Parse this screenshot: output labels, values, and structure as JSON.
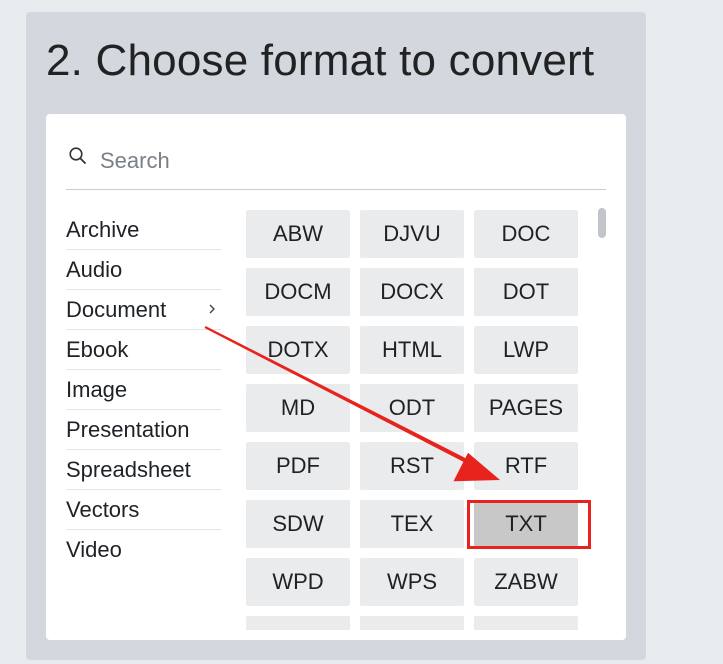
{
  "title": "2. Choose format to convert",
  "search": {
    "placeholder": "Search"
  },
  "categories": [
    {
      "label": "Archive"
    },
    {
      "label": "Audio"
    },
    {
      "label": "Document"
    },
    {
      "label": "Ebook"
    },
    {
      "label": "Image"
    },
    {
      "label": "Presentation"
    },
    {
      "label": "Spreadsheet"
    },
    {
      "label": "Vectors"
    },
    {
      "label": "Video"
    }
  ],
  "active_category": "Document",
  "formats": [
    "ABW",
    "DJVU",
    "DOC",
    "DOCM",
    "DOCX",
    "DOT",
    "DOTX",
    "HTML",
    "LWP",
    "MD",
    "ODT",
    "PAGES",
    "PDF",
    "RST",
    "RTF",
    "SDW",
    "TEX",
    "TXT",
    "WPD",
    "WPS",
    "ZABW"
  ],
  "selected_format": "TXT",
  "colors": {
    "annotation_red": "#e8231d",
    "selected_bg": "#c8c8c8",
    "button_bg": "#e9ebed",
    "panel_bg": "#d3d8de"
  }
}
